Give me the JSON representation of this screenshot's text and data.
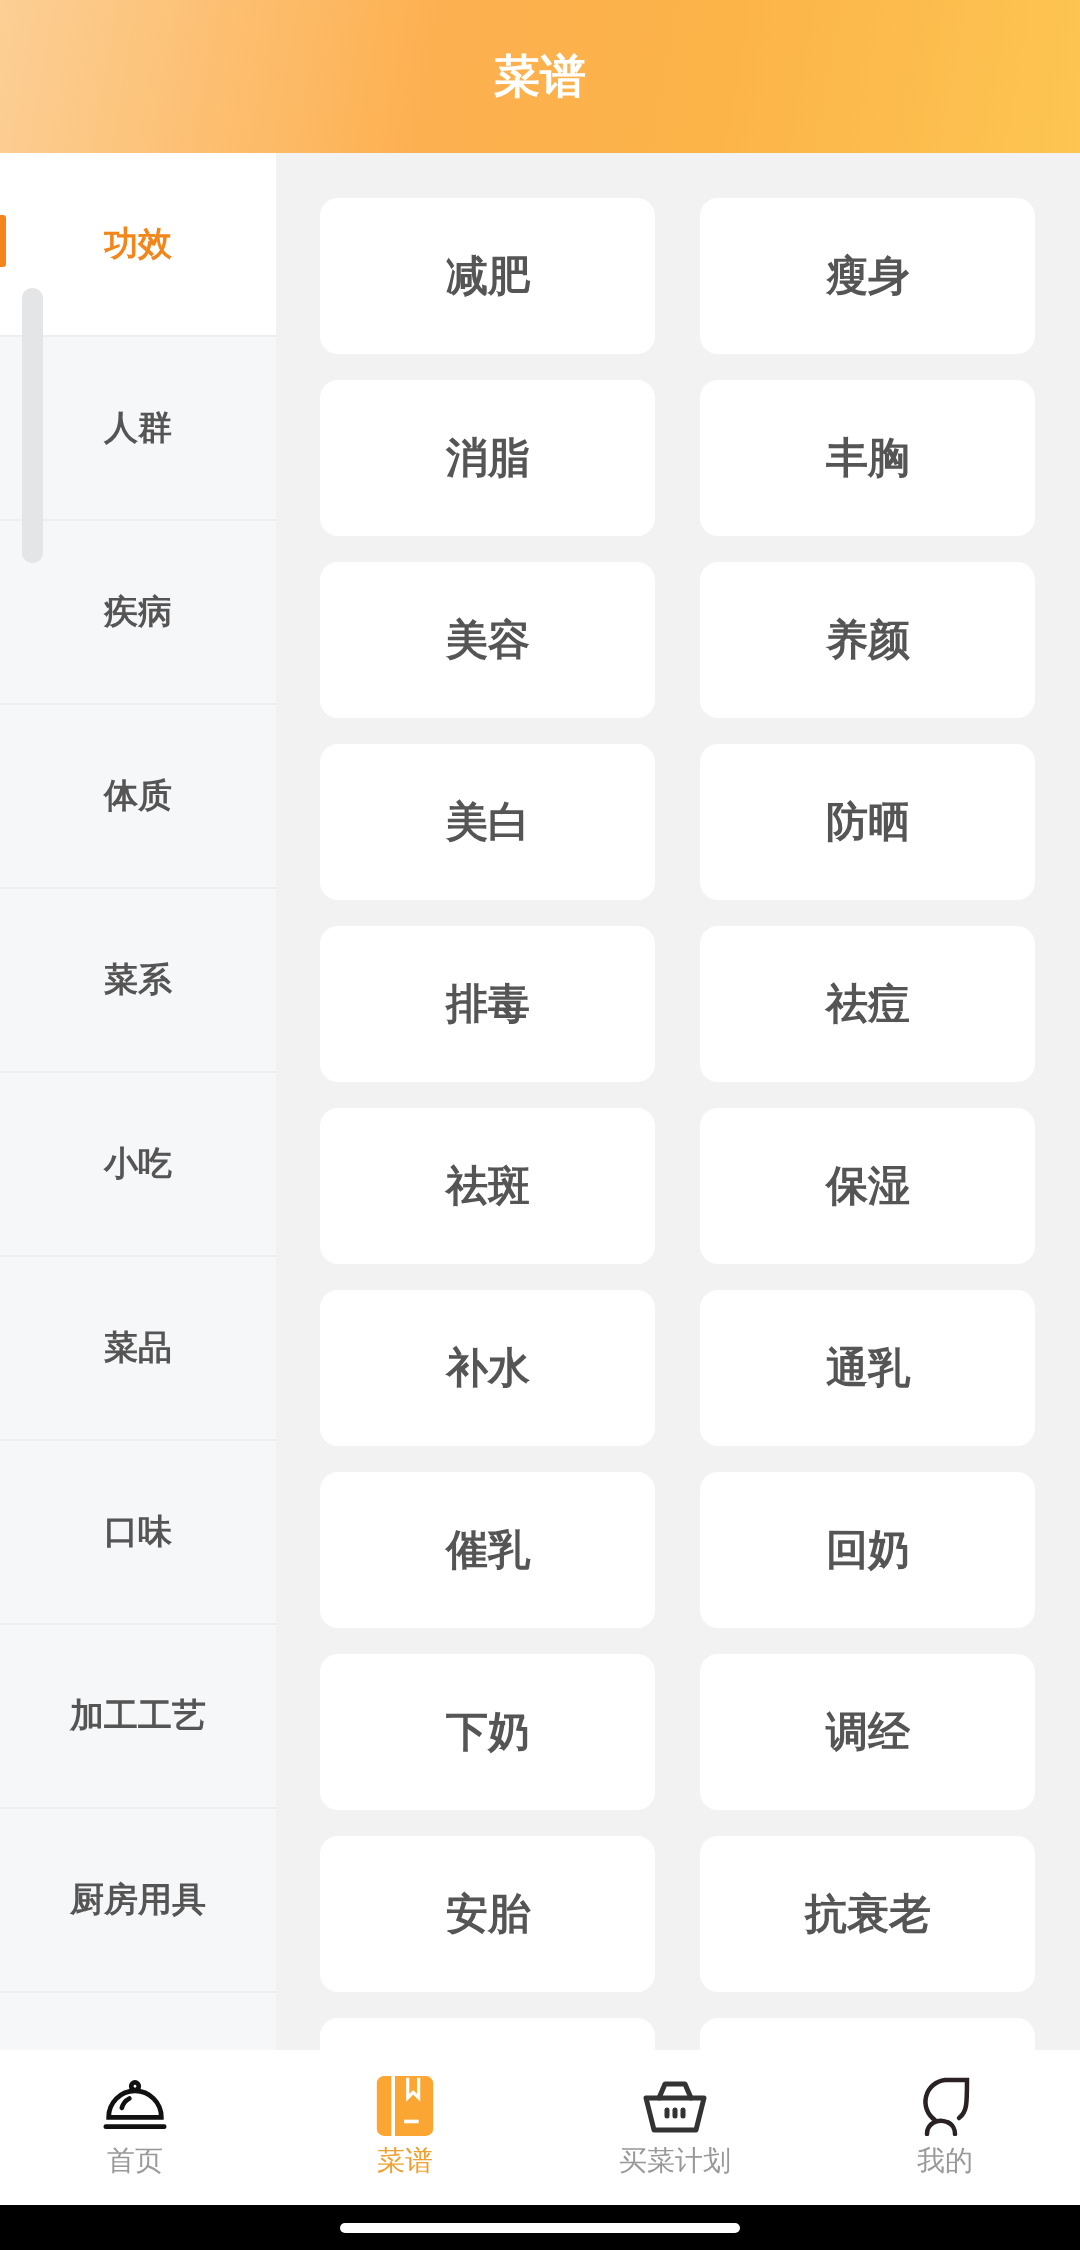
{
  "header": {
    "title": "菜谱"
  },
  "sidebar": {
    "items": [
      {
        "label": "功效",
        "selected": true
      },
      {
        "label": "人群",
        "selected": false
      },
      {
        "label": "疾病",
        "selected": false
      },
      {
        "label": "体质",
        "selected": false
      },
      {
        "label": "菜系",
        "selected": false
      },
      {
        "label": "小吃",
        "selected": false
      },
      {
        "label": "菜品",
        "selected": false
      },
      {
        "label": "口味",
        "selected": false
      },
      {
        "label": "加工工艺",
        "selected": false
      },
      {
        "label": "厨房用具",
        "selected": false
      }
    ]
  },
  "tags": [
    "减肥",
    "瘦身",
    "消脂",
    "丰胸",
    "美容",
    "养颜",
    "美白",
    "防晒",
    "排毒",
    "祛痘",
    "祛斑",
    "保湿",
    "补水",
    "通乳",
    "催乳",
    "回奶",
    "下奶",
    "调经",
    "安胎",
    "抗衰老"
  ],
  "tab_bar": [
    {
      "label": "首页",
      "kind": "cloche",
      "selected": false
    },
    {
      "label": "菜谱",
      "kind": "book",
      "selected": true
    },
    {
      "label": "买菜计划",
      "kind": "basket",
      "selected": false
    },
    {
      "label": "我的",
      "kind": "person",
      "selected": false
    }
  ]
}
